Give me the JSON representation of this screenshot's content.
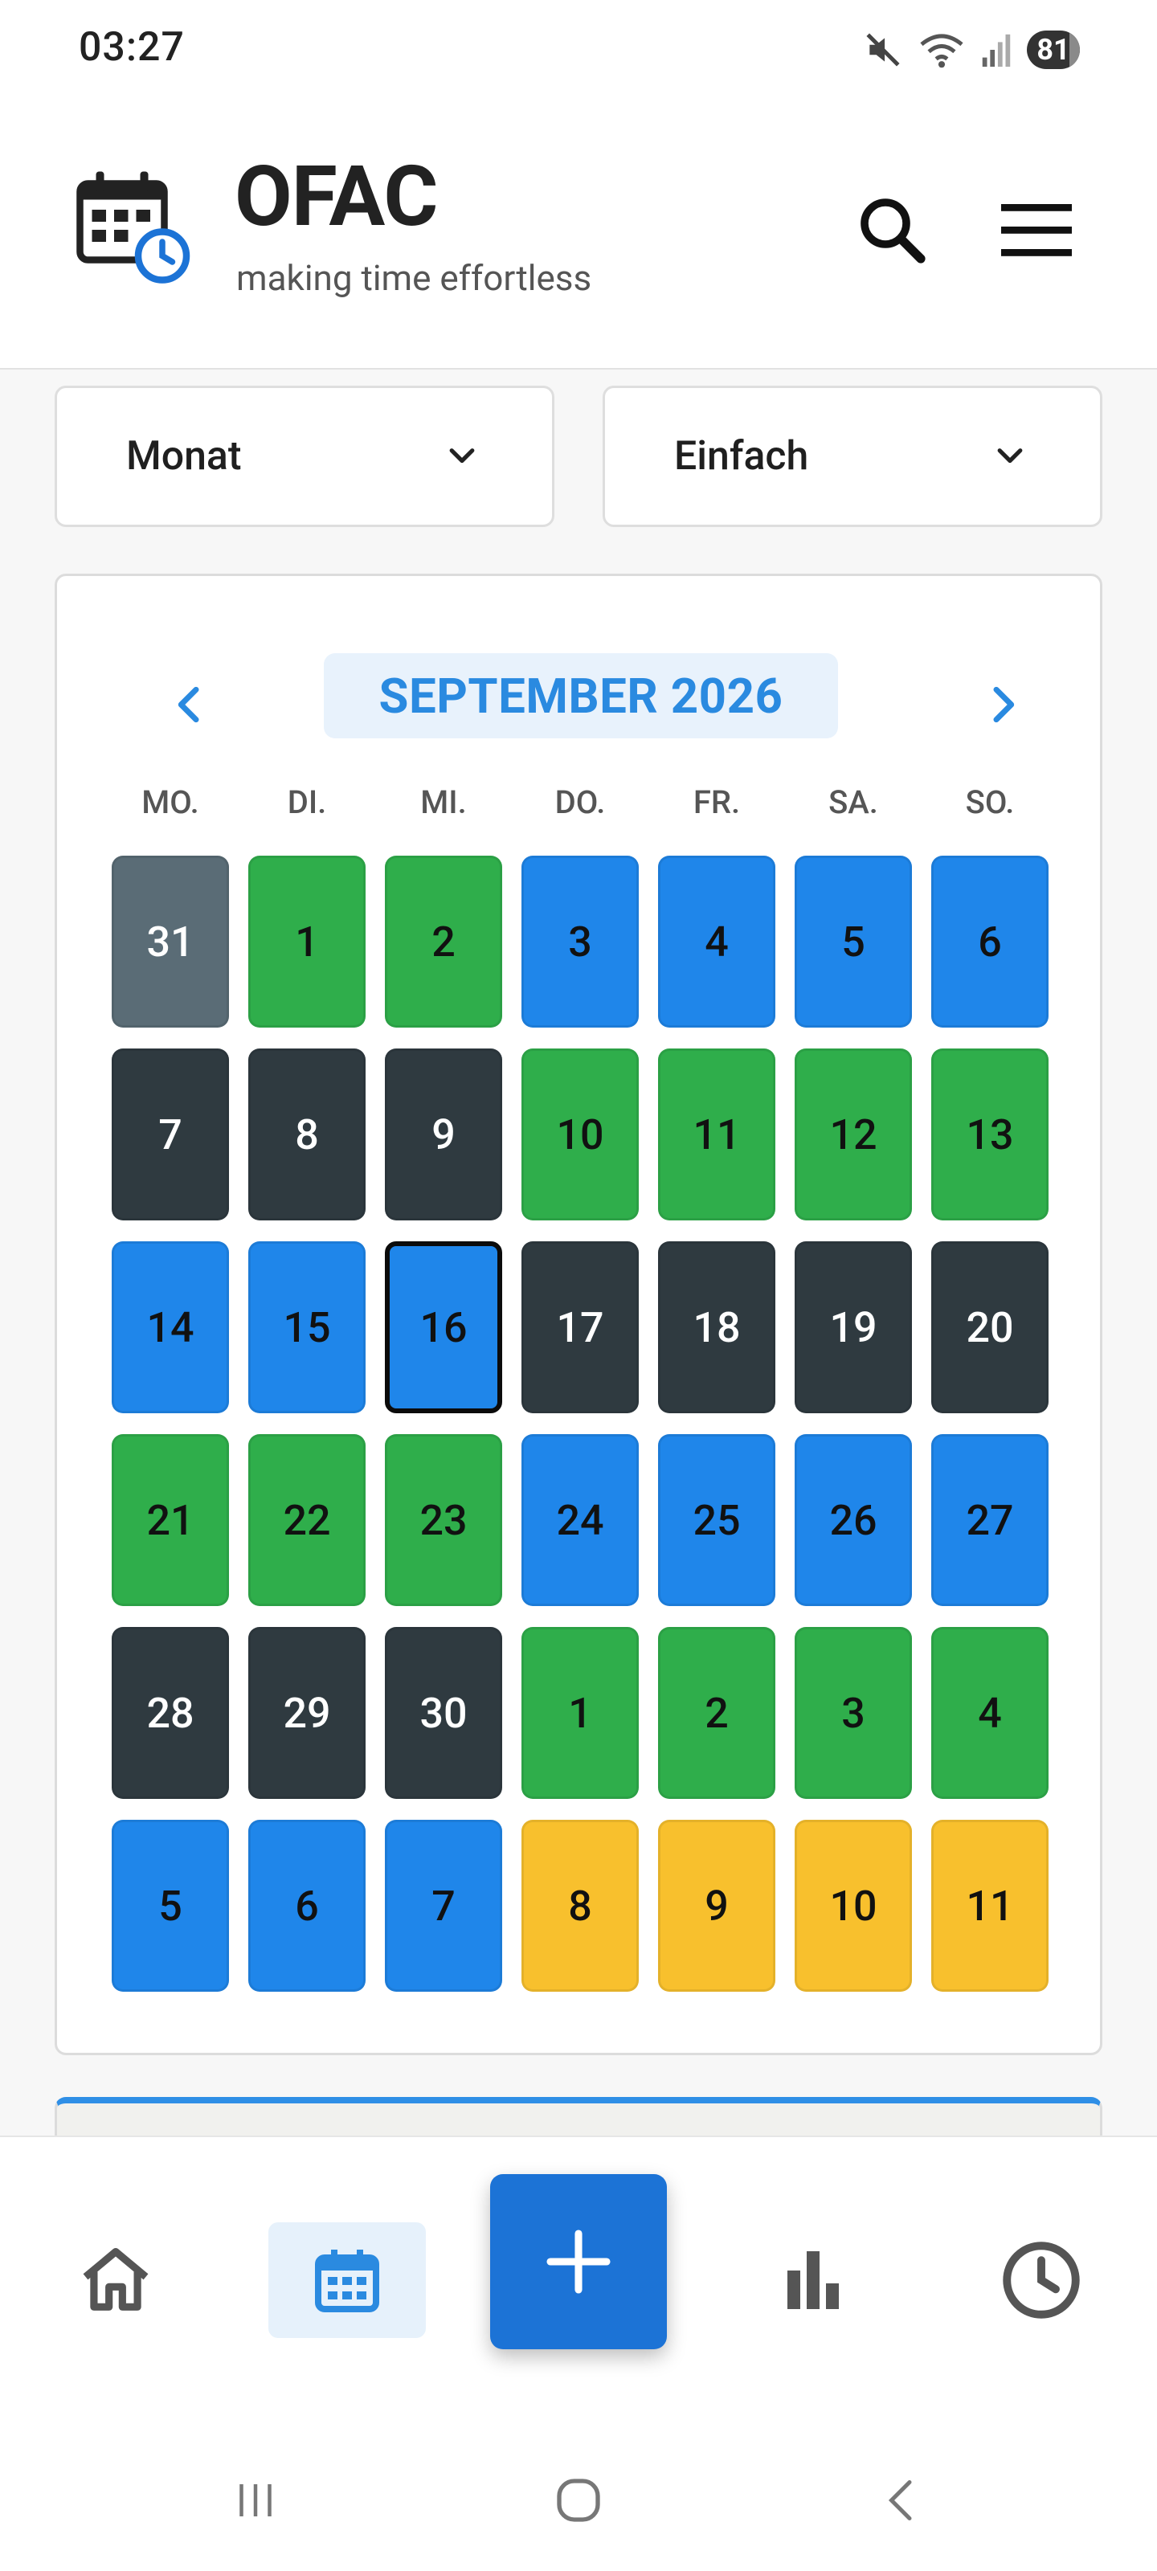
{
  "status_bar": {
    "time": "03:27",
    "battery": "81",
    "battery_fraction": 0.81,
    "icons": [
      "mute-icon",
      "wifi-icon",
      "signal-icon",
      "battery-icon"
    ]
  },
  "app_bar": {
    "title": "OFAC",
    "subtitle": "making time effortless",
    "icons": [
      "calendar-clock-logo-icon",
      "search-icon",
      "menu-icon"
    ]
  },
  "filters": {
    "view": {
      "selected": "Monat"
    },
    "mode": {
      "selected": "Einfach"
    }
  },
  "calendar": {
    "month_label": "SEPTEMBER 2026",
    "weekdays": [
      "MO.",
      "DI.",
      "MI.",
      "DO.",
      "FR.",
      "SA.",
      "SO."
    ],
    "weeks": [
      [
        {
          "n": "31",
          "c": "gray"
        },
        {
          "n": "1",
          "c": "green"
        },
        {
          "n": "2",
          "c": "green"
        },
        {
          "n": "3",
          "c": "blue"
        },
        {
          "n": "4",
          "c": "blue"
        },
        {
          "n": "5",
          "c": "blue"
        },
        {
          "n": "6",
          "c": "blue"
        }
      ],
      [
        {
          "n": "7",
          "c": "dark"
        },
        {
          "n": "8",
          "c": "dark"
        },
        {
          "n": "9",
          "c": "dark"
        },
        {
          "n": "10",
          "c": "green"
        },
        {
          "n": "11",
          "c": "green"
        },
        {
          "n": "12",
          "c": "green"
        },
        {
          "n": "13",
          "c": "green"
        }
      ],
      [
        {
          "n": "14",
          "c": "blue"
        },
        {
          "n": "15",
          "c": "blue"
        },
        {
          "n": "16",
          "c": "blue",
          "selected": true
        },
        {
          "n": "17",
          "c": "dark"
        },
        {
          "n": "18",
          "c": "dark"
        },
        {
          "n": "19",
          "c": "dark"
        },
        {
          "n": "20",
          "c": "dark"
        }
      ],
      [
        {
          "n": "21",
          "c": "green"
        },
        {
          "n": "22",
          "c": "green"
        },
        {
          "n": "23",
          "c": "green"
        },
        {
          "n": "24",
          "c": "blue"
        },
        {
          "n": "25",
          "c": "blue"
        },
        {
          "n": "26",
          "c": "blue"
        },
        {
          "n": "27",
          "c": "blue"
        }
      ],
      [
        {
          "n": "28",
          "c": "dark"
        },
        {
          "n": "29",
          "c": "dark"
        },
        {
          "n": "30",
          "c": "dark"
        },
        {
          "n": "1",
          "c": "green"
        },
        {
          "n": "2",
          "c": "green"
        },
        {
          "n": "3",
          "c": "green"
        },
        {
          "n": "4",
          "c": "green"
        }
      ],
      [
        {
          "n": "5",
          "c": "blue"
        },
        {
          "n": "6",
          "c": "blue"
        },
        {
          "n": "7",
          "c": "blue"
        },
        {
          "n": "8",
          "c": "yellow"
        },
        {
          "n": "9",
          "c": "yellow"
        },
        {
          "n": "10",
          "c": "yellow"
        },
        {
          "n": "11",
          "c": "yellow"
        }
      ]
    ],
    "palette": {
      "gray": {
        "bg": "#5a6c76",
        "fg": "#ffffff"
      },
      "green": {
        "bg": "#2fae4b",
        "fg": "#111111"
      },
      "blue": {
        "bg": "#1f86ea",
        "fg": "#111111"
      },
      "dark": {
        "bg": "#2f3a40",
        "fg": "#ffffff"
      },
      "yellow": {
        "bg": "#f8c02d",
        "fg": "#111111"
      }
    }
  },
  "bottom_nav": {
    "items": [
      "home-icon",
      "calendar-icon",
      "add-icon",
      "stats-icon",
      "history-icon"
    ],
    "active": "calendar-icon"
  },
  "system_nav": [
    "recent-apps-icon",
    "home-button-icon",
    "back-icon"
  ],
  "colors": {
    "accent": "#2a8ae0",
    "fab": "#1c73d6"
  }
}
